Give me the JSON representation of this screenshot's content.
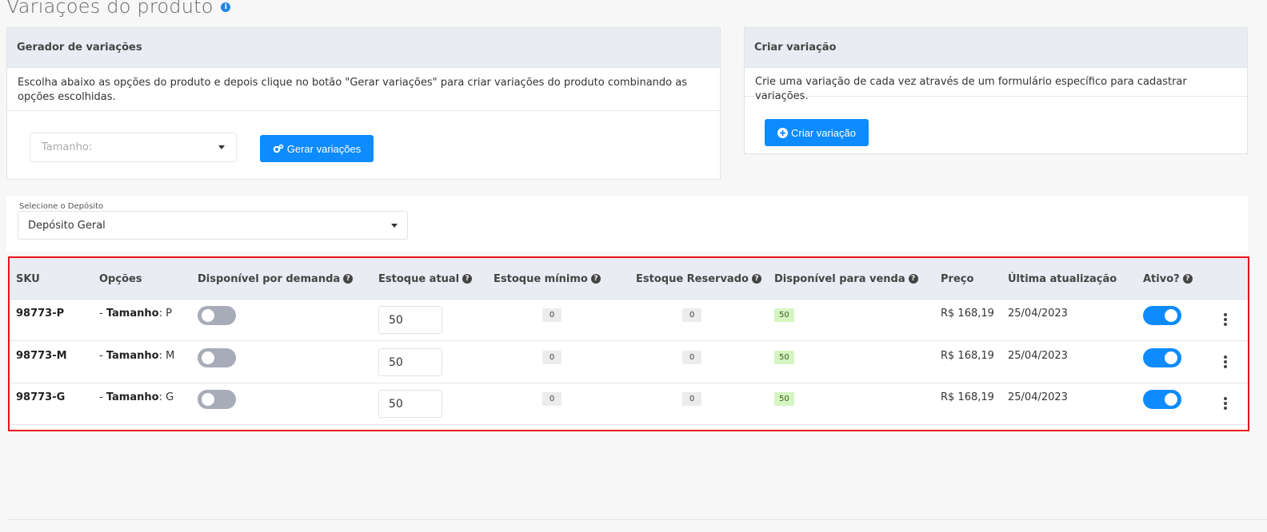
{
  "page": {
    "title": "Variações do produto",
    "info_glyph": "i"
  },
  "generator": {
    "header": "Gerador de variações",
    "description": "Escolha abaixo as opções do produto e depois clique no botão \"Gerar variações\" para criar variações do produto combinando as opções escolhidas.",
    "select_placeholder": "Tamanho:",
    "button_label": "Gerar variações"
  },
  "creator": {
    "header": "Criar variação",
    "description": "Crie uma variação de cada vez através de um formulário específico para cadastrar variações.",
    "button_label": "Criar variação"
  },
  "deposit": {
    "label": "Selecione o Depósito",
    "selected": "Depósito Geral"
  },
  "table": {
    "help_glyph": "?",
    "columns": {
      "sku": "SKU",
      "options": "Opções",
      "on_demand": "Disponível por demanda",
      "current_stock": "Estoque atual",
      "min_stock": "Estoque mínimo",
      "reserved_stock": "Estoque Reservado",
      "available": "Disponível para venda",
      "price": "Preço",
      "last_update": "Última atualização",
      "active": "Ativo?"
    },
    "rows": [
      {
        "sku": "98773-P",
        "option_prefix": "- ",
        "option_name": "Tamanho",
        "option_value": ": P",
        "on_demand": false,
        "current_stock": "50",
        "min_stock": "0",
        "reserved": "0",
        "available": "50",
        "price": "R$ 168,19",
        "last_update": "25/04/2023",
        "active": true
      },
      {
        "sku": "98773-M",
        "option_prefix": "- ",
        "option_name": "Tamanho",
        "option_value": ": M",
        "on_demand": false,
        "current_stock": "50",
        "min_stock": "0",
        "reserved": "0",
        "available": "50",
        "price": "R$ 168,19",
        "last_update": "25/04/2023",
        "active": true
      },
      {
        "sku": "98773-G",
        "option_prefix": "- ",
        "option_name": "Tamanho",
        "option_value": ": G",
        "on_demand": false,
        "current_stock": "50",
        "min_stock": "0",
        "reserved": "0",
        "available": "50",
        "price": "R$ 168,19",
        "last_update": "25/04/2023",
        "active": true
      }
    ]
  },
  "colors": {
    "primary": "#0d8bff",
    "highlight_border": "#e8141b",
    "toggle_off": "#a8abb8",
    "available_badge": "#d5f5c2",
    "header_bg": "#e9ecf2"
  },
  "icons": {
    "info": "info-icon",
    "help": "question-circle-icon",
    "gear": "gears-icon",
    "plus": "plus-circle-icon",
    "caret": "caret-down-icon",
    "menu": "kebab-icon"
  }
}
